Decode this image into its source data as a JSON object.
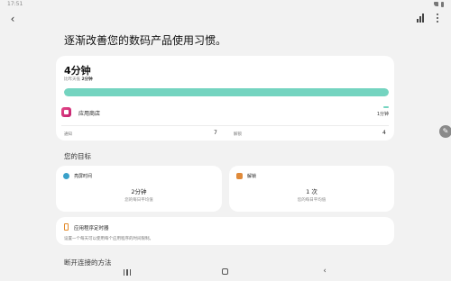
{
  "status_bar": {
    "time": "17:51"
  },
  "header": {
    "back_icon": "chevron-left-icon",
    "chart_icon": "bar-chart-icon",
    "more_icon": "more-vertical-icon",
    "headline": "逐渐改善您的数码产品使用习惯。"
  },
  "summary": {
    "total_time": "4分钟",
    "prev_week_prefix": "比昨天低",
    "prev_week_value": "2分钟",
    "usage_fraction": 1.0,
    "accent_color": "#74d4c0"
  },
  "app_usage": [
    {
      "name": "应用商店",
      "time": "1分钟",
      "icon": "galaxy-store-icon"
    }
  ],
  "stats": [
    {
      "label": "通知",
      "value": "7"
    },
    {
      "label": "解锁",
      "value": "4"
    }
  ],
  "goals": {
    "section_title": "您的目标",
    "screen_time": {
      "label": "亮屏时间",
      "value": "2分钟",
      "sub": "您的每日平均值",
      "icon": "screen-time-icon",
      "color": "#3aa1c9"
    },
    "unlocks": {
      "label": "解锁",
      "value": "1 次",
      "sub": "您的每日平均值",
      "icon": "unlock-icon",
      "color": "#e08a3a"
    }
  },
  "app_timer": {
    "label": "应用程序定时器",
    "desc": "设置一个每天可以使用每个应用程序的时间限制。",
    "icon": "hourglass-icon"
  },
  "disconnect": {
    "section_title": "断开连接的方法"
  },
  "fab": {
    "icon": "edit-pen-icon"
  },
  "navbar": {
    "recent_icon": "recent-apps-icon",
    "home_icon": "home-icon",
    "back_icon": "back-icon"
  }
}
